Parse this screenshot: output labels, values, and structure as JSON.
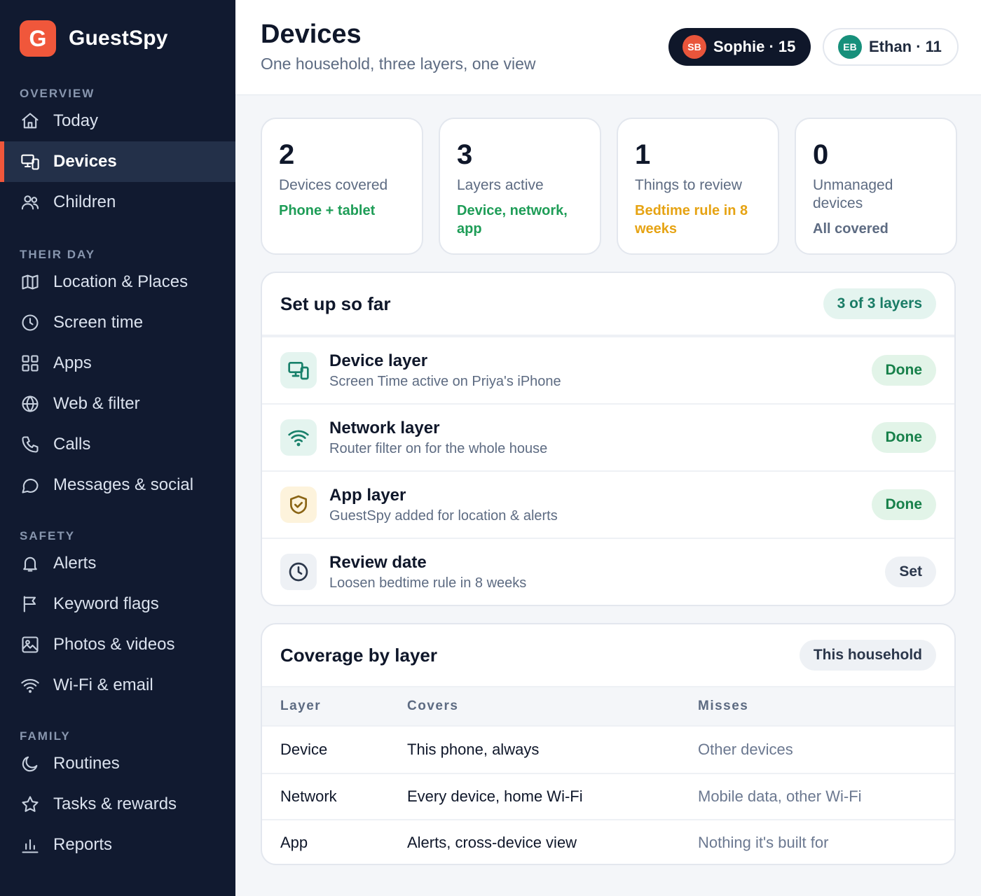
{
  "app": {
    "logo_letter": "G",
    "name": "GuestSpy"
  },
  "sidebar": {
    "sections": [
      {
        "label": "OVERVIEW",
        "items": [
          {
            "label": "Today",
            "icon": "home-icon"
          },
          {
            "label": "Devices",
            "icon": "devices-icon",
            "active": true
          },
          {
            "label": "Children",
            "icon": "users-icon"
          }
        ]
      },
      {
        "label": "THEIR DAY",
        "items": [
          {
            "label": "Location & Places",
            "icon": "map-icon"
          },
          {
            "label": "Screen time",
            "icon": "clock-icon"
          },
          {
            "label": "Apps",
            "icon": "grid-icon"
          },
          {
            "label": "Web & filter",
            "icon": "globe-icon"
          },
          {
            "label": "Calls",
            "icon": "phone-icon"
          },
          {
            "label": "Messages & social",
            "icon": "chat-icon"
          }
        ]
      },
      {
        "label": "SAFETY",
        "items": [
          {
            "label": "Alerts",
            "icon": "bell-icon"
          },
          {
            "label": "Keyword flags",
            "icon": "flag-icon"
          },
          {
            "label": "Photos & videos",
            "icon": "image-icon"
          },
          {
            "label": "Wi-Fi & email",
            "icon": "wifi-icon"
          }
        ]
      },
      {
        "label": "FAMILY",
        "items": [
          {
            "label": "Routines",
            "icon": "moon-icon"
          },
          {
            "label": "Tasks & rewards",
            "icon": "star-icon"
          },
          {
            "label": "Reports",
            "icon": "bar-chart-icon"
          }
        ]
      }
    ]
  },
  "header": {
    "title": "Devices",
    "subtitle": "One household, three layers, one view",
    "children": [
      {
        "initials": "SB",
        "label": "Sophie · 15",
        "selected": true
      },
      {
        "initials": "EB",
        "label": "Ethan · 11",
        "selected": false
      }
    ]
  },
  "stats": [
    {
      "value": "2",
      "label": "Devices covered",
      "note": "Phone + tablet",
      "tone": "green"
    },
    {
      "value": "3",
      "label": "Layers active",
      "note": "Device, network, app",
      "tone": "green"
    },
    {
      "value": "1",
      "label": "Things to review",
      "note": "Bedtime rule in 8 weeks",
      "tone": "amber"
    },
    {
      "value": "0",
      "label": "Unmanaged devices",
      "note": "All covered",
      "tone": "slate"
    }
  ],
  "setup": {
    "title": "Set up so far",
    "badge": "3 of 3 layers",
    "rows": [
      {
        "title": "Device layer",
        "subtitle": "Screen Time active on Priya's iPhone",
        "status": "Done",
        "icon": "devices-icon"
      },
      {
        "title": "Network layer",
        "subtitle": "Router filter on for the whole house",
        "status": "Done",
        "icon": "wifi-icon"
      },
      {
        "title": "App layer",
        "subtitle": "GuestSpy added for location & alerts",
        "status": "Done",
        "icon": "shield-check-icon"
      },
      {
        "title": "Review date",
        "subtitle": "Loosen bedtime rule in 8 weeks",
        "status": "Set",
        "icon": "clock-icon"
      }
    ]
  },
  "coverage": {
    "title": "Coverage by layer",
    "badge": "This household",
    "columns": [
      "Layer",
      "Covers",
      "Misses"
    ],
    "rows": [
      [
        "Device",
        "This phone, always",
        "Other devices"
      ],
      [
        "Network",
        "Every device, home Wi-Fi",
        "Mobile data, other Wi-Fi"
      ],
      [
        "App",
        "Alerts, cross-device view",
        "Nothing it's built for"
      ]
    ]
  },
  "colors": {
    "brand": "#f0573b",
    "sidebar_bg": "#111a30",
    "done": "#17804a",
    "review": "#e6a313"
  }
}
